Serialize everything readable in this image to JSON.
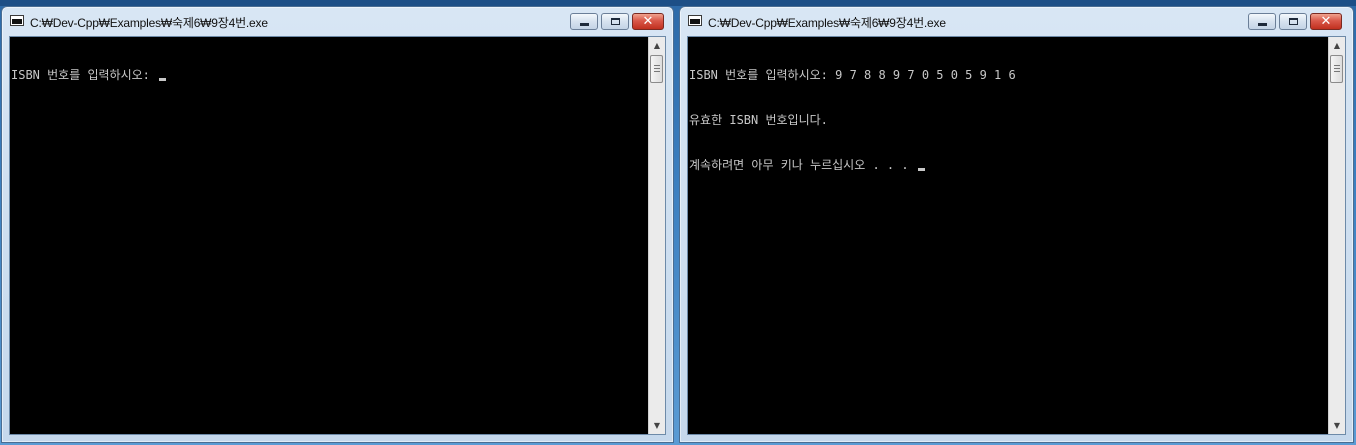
{
  "windows": [
    {
      "title": "C:₩Dev-Cpp₩Examples₩숙제6₩9장4번.exe",
      "console_lines": [
        "ISBN 번호를 입력하시오: "
      ]
    },
    {
      "title": "C:₩Dev-Cpp₩Examples₩숙제6₩9장4번.exe",
      "console_lines": [
        "ISBN 번호를 입력하시오: 9 7 8 8 9 7 0 5 0 5 9 1 6",
        "유효한 ISBN 번호입니다.",
        "계속하려면 아무 키나 누르십시오 . . . "
      ]
    }
  ],
  "icons": {
    "app": "console-app-icon",
    "minimize": "minimize-icon",
    "maximize": "maximize-icon",
    "close": "close-icon",
    "scroll_up": "scroll-up-arrow-icon",
    "scroll_down": "scroll-down-arrow-icon"
  },
  "colors": {
    "console_bg": "#000000",
    "console_fg": "#c8c8c8",
    "close_button": "#c0301f"
  }
}
